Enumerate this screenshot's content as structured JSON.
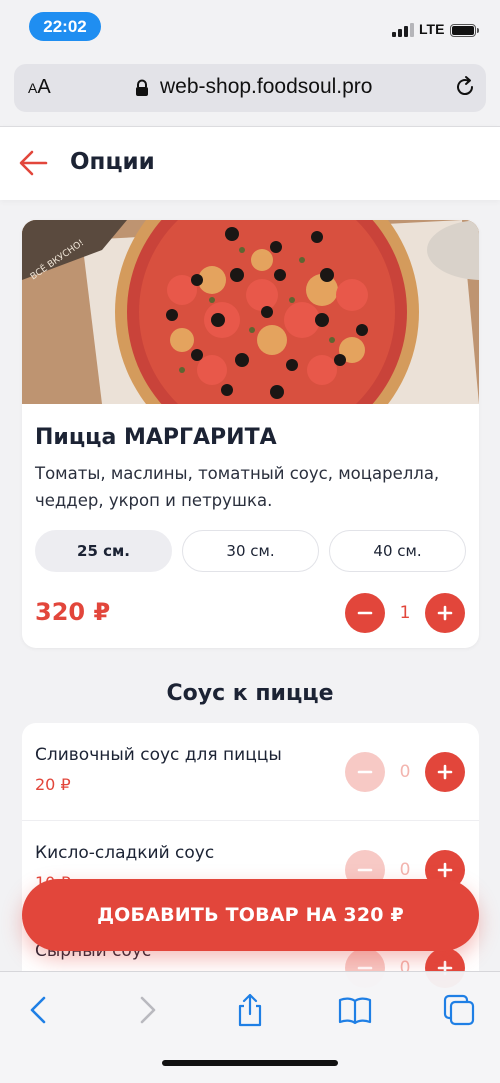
{
  "status_bar": {
    "time": "22:02",
    "network": "LTE"
  },
  "browser": {
    "text_size_label": "AA",
    "url": "web-shop.foodsoul.pro"
  },
  "header": {
    "title": "Опции"
  },
  "product": {
    "name": "Пицца МАРГАРИТА",
    "description": "Томаты, маслины, томатный соус, моцарелла, чеддер, укроп и петрушка.",
    "box_text": "ВСЁ ВКУСНО!",
    "sizes": [
      {
        "label": "25 см.",
        "selected": true
      },
      {
        "label": "30 см.",
        "selected": false
      },
      {
        "label": "40 см.",
        "selected": false
      }
    ],
    "price": "320 ₽",
    "quantity": "1"
  },
  "sauces": {
    "title": "Соус к пицце",
    "items": [
      {
        "name": "Сливочный соус для пиццы",
        "price": "20 ₽",
        "quantity": "0"
      },
      {
        "name": "Кисло-сладкий соус",
        "price": "10 ₽",
        "quantity": "0"
      },
      {
        "name": "Сырный соус",
        "price": "",
        "quantity": "0"
      }
    ]
  },
  "add_to_cart": {
    "label": "ДОБАВИТЬ ТОВАР НА 320 ₽"
  },
  "colors": {
    "accent": "#e2463b",
    "time_pill": "#1f8ef1",
    "safari_blue": "#1f7fe5"
  },
  "icons": [
    "back-arrow-icon",
    "lock-icon",
    "reload-icon",
    "minus-icon",
    "plus-icon",
    "share-icon",
    "bookmarks-icon",
    "tabs-icon"
  ]
}
